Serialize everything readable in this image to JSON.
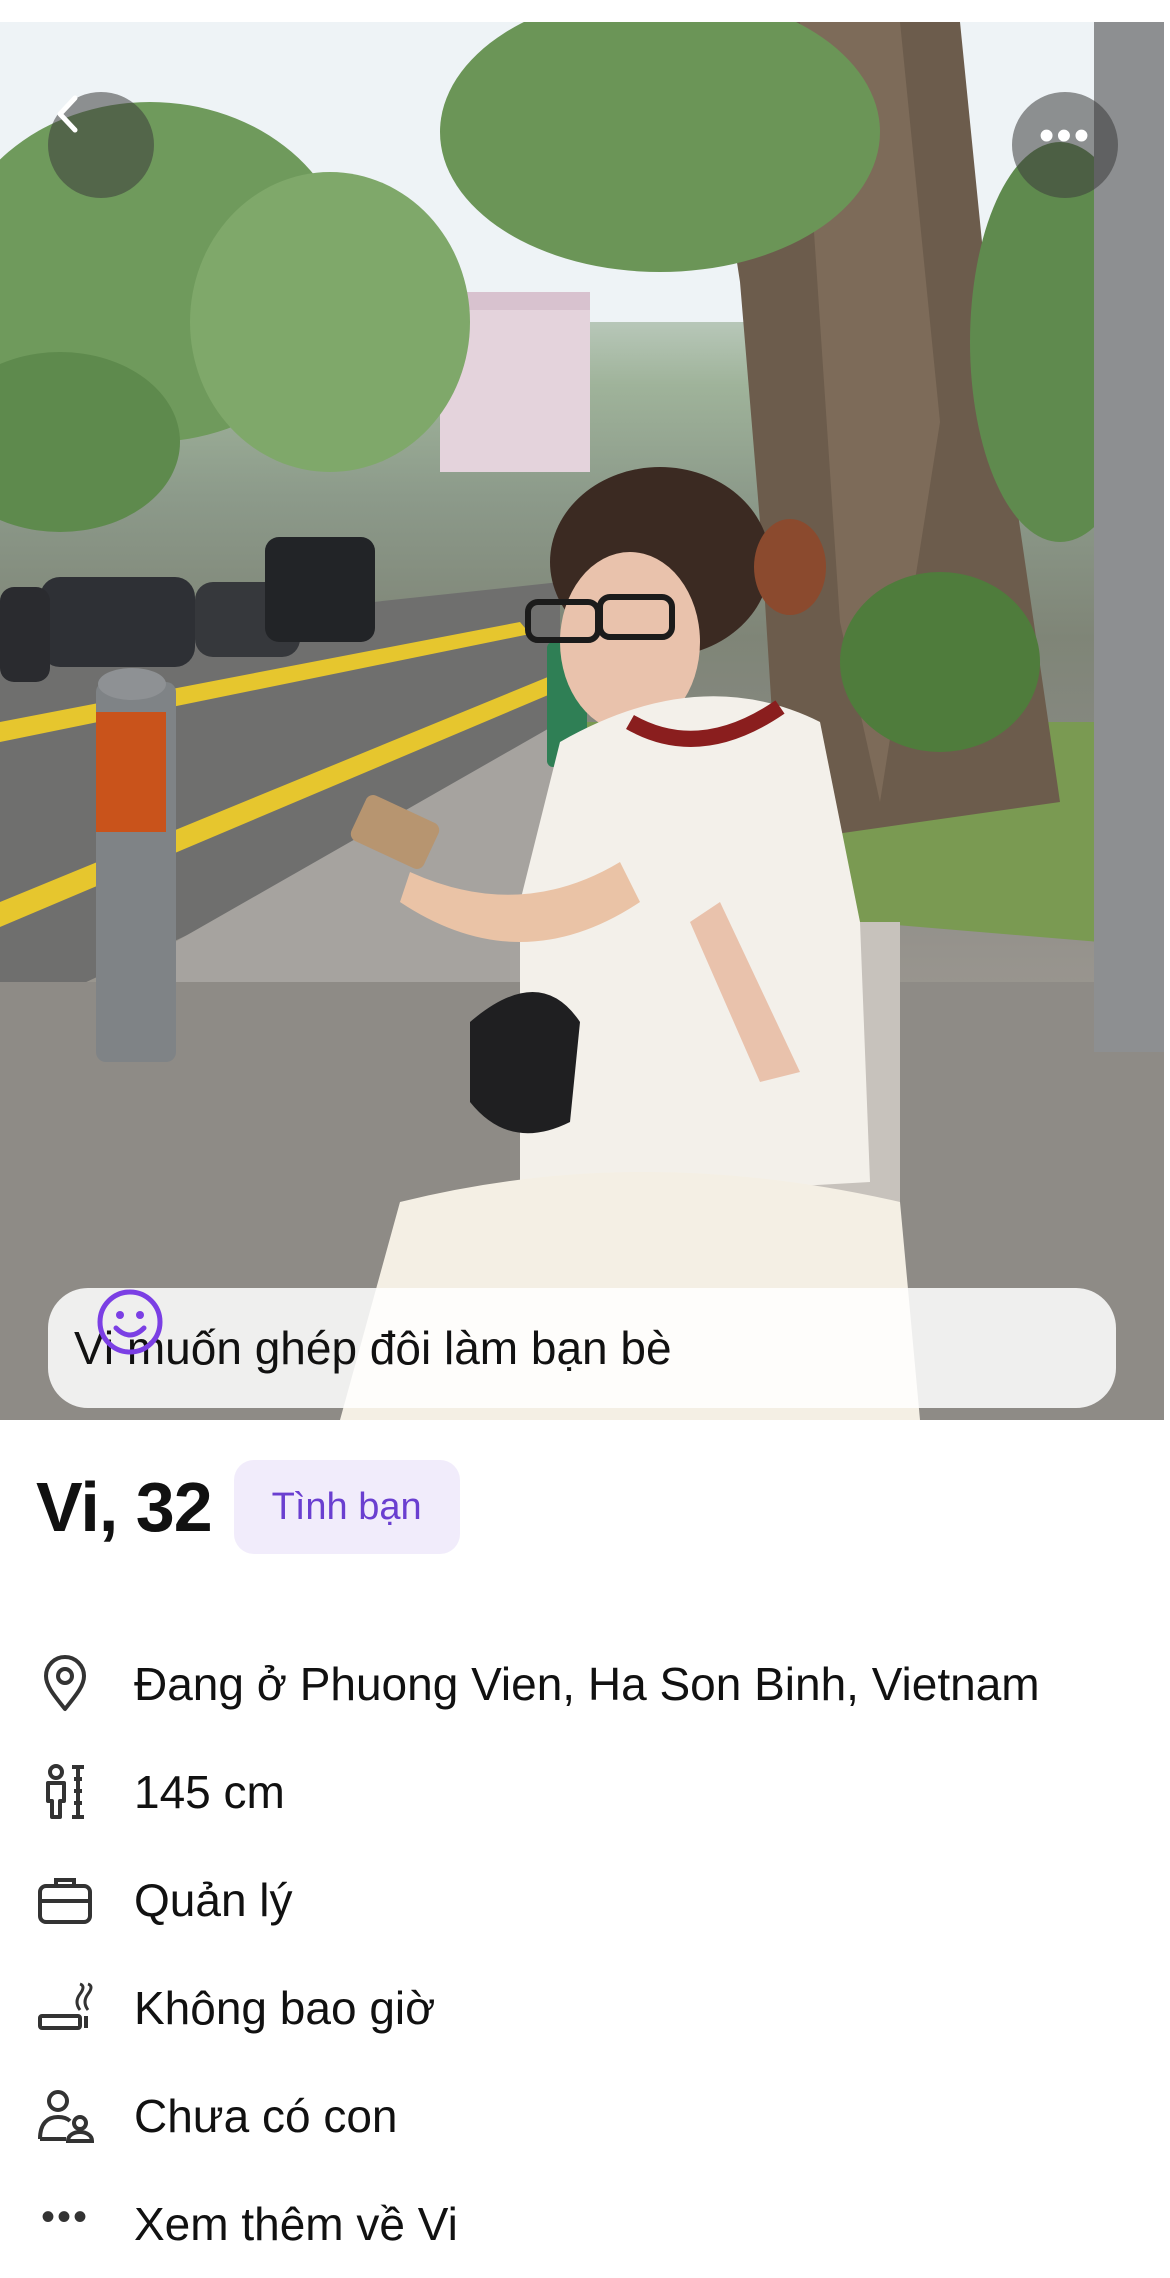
{
  "photo": {
    "alt_subject": "profile-photo"
  },
  "header": {
    "back_icon": "chevron-left-icon",
    "more_icon": "more-horizontal-icon",
    "more_glyph": "•••"
  },
  "intent": {
    "icon": "smiley-icon",
    "text": "Vi muốn ghép đôi làm bạn bè",
    "accent": "#7b3fe4"
  },
  "profile": {
    "name_age": "Vi, 32",
    "tag": "Tình bạn"
  },
  "details": [
    {
      "icon": "location-pin-icon",
      "text": "Đang ở Phuong Vien, Ha Son Binh, Vietnam"
    },
    {
      "icon": "height-icon",
      "text": "145 cm"
    },
    {
      "icon": "briefcase-icon",
      "text": "Quản lý"
    },
    {
      "icon": "smoking-icon",
      "text": "Không bao giờ"
    },
    {
      "icon": "children-icon",
      "text": "Chưa có con"
    },
    {
      "icon": "more-dots-icon",
      "glyph": "•••",
      "text": "Xem thêm về Vi"
    }
  ]
}
